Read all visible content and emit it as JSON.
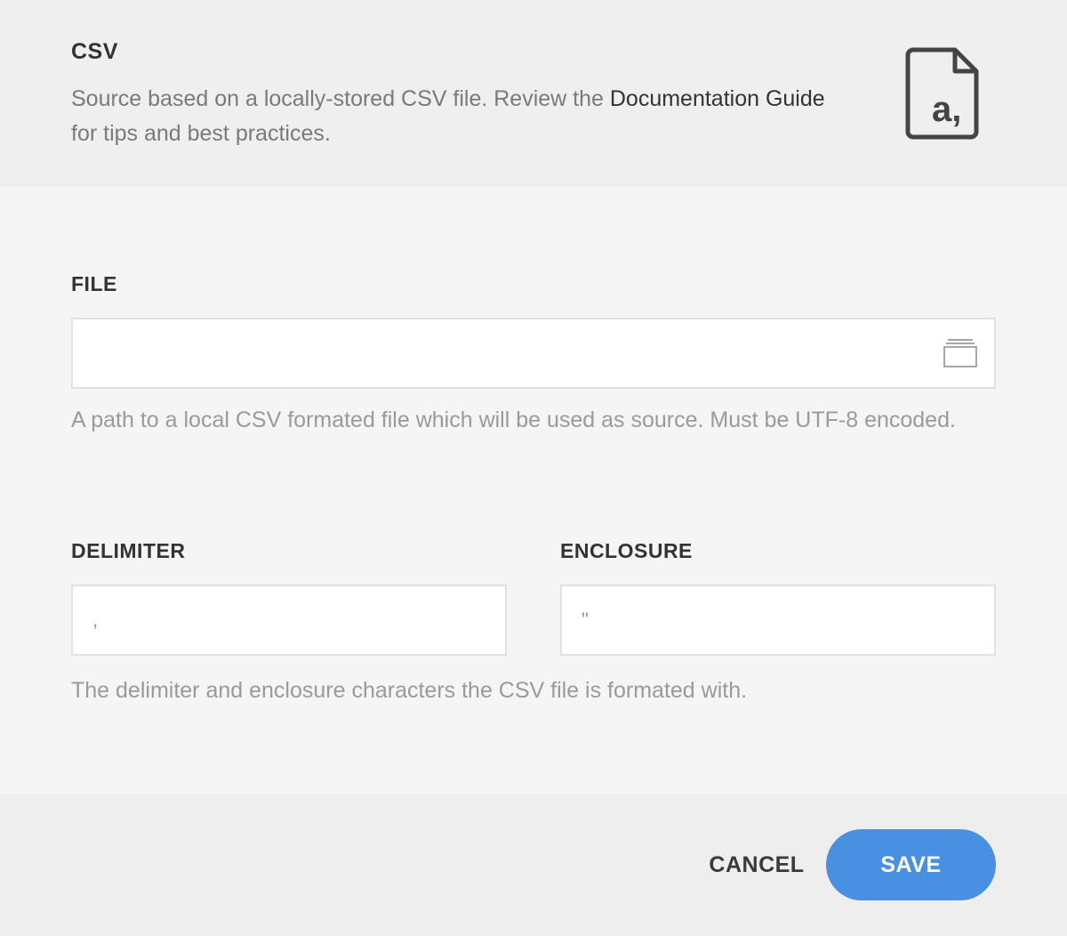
{
  "header": {
    "title": "CSV",
    "description_prefix": "Source based on a locally-stored CSV file. Review the ",
    "doc_link": "Documentation Guide",
    "description_suffix": " for tips and best practices.",
    "icon": "csv-file-icon",
    "icon_glyph": "a,"
  },
  "file": {
    "label": "FILE",
    "value": "",
    "placeholder": "",
    "browse_icon": "folder-browse-icon",
    "help": "A path to a local CSV formated file which will be used as source. Must be UTF-8 encoded."
  },
  "delimiter": {
    "label": "DELIMITER",
    "placeholder": ","
  },
  "enclosure": {
    "label": "ENCLOSURE",
    "placeholder": "\""
  },
  "format_help": "The delimiter and enclosure characters the CSV file is formated with.",
  "footer": {
    "cancel_label": "CANCEL",
    "save_label": "SAVE"
  },
  "colors": {
    "accent": "#4a90e2",
    "header_bg": "#efefef",
    "body_bg": "#f5f5f5",
    "footer_bg": "#eeeeee",
    "text_dark": "#333333",
    "text_muted": "#7a7a7a"
  }
}
